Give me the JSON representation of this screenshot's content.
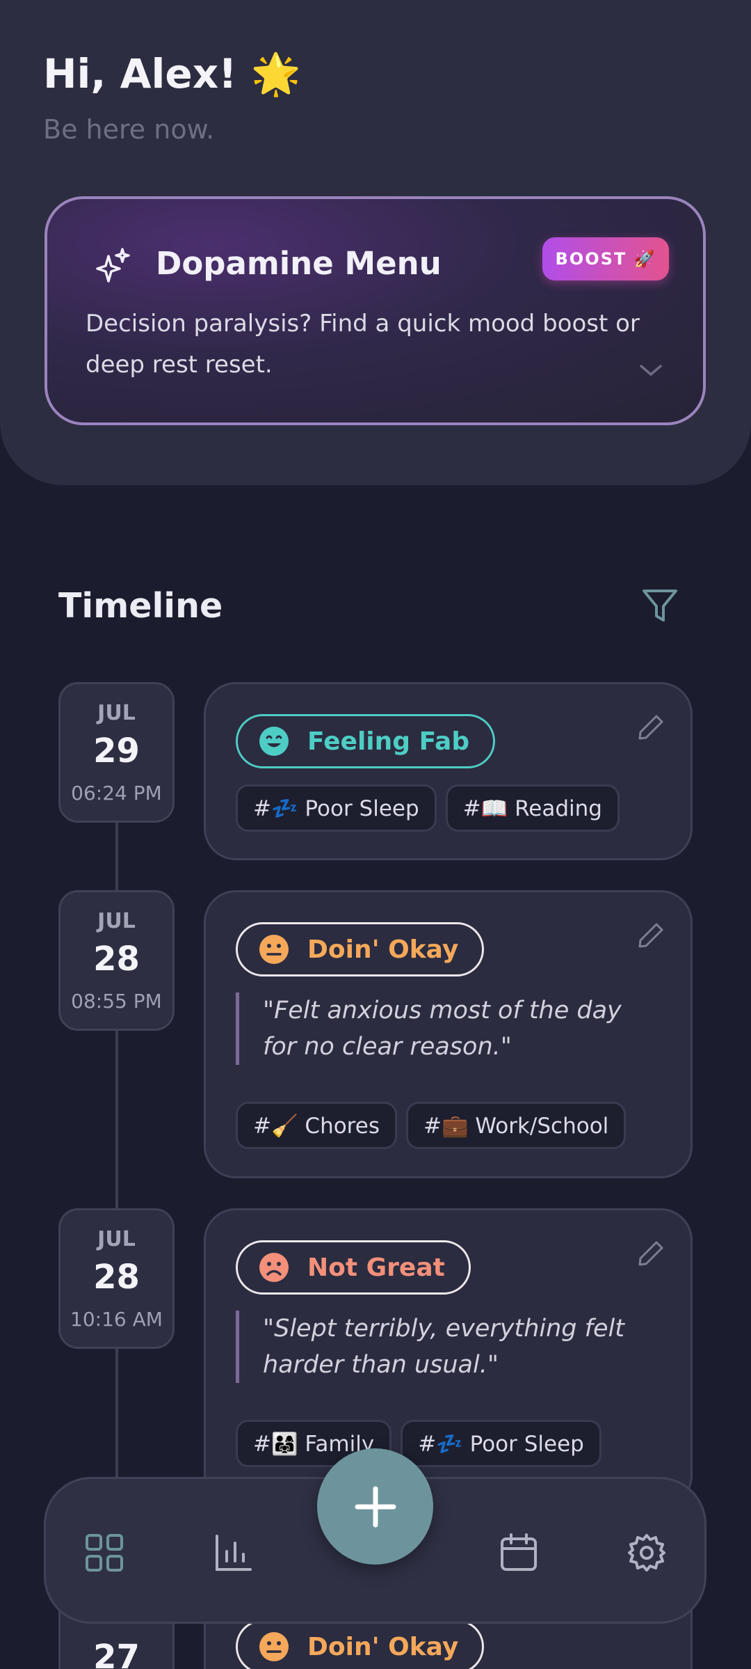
{
  "header": {
    "greeting": "Hi, Alex! 🌟",
    "subtitle": "Be here now."
  },
  "dopamine_menu": {
    "title": "Dopamine Menu",
    "boost_label": "BOOST 🚀",
    "description": "Decision paralysis? Find a quick mood boost or deep rest reset."
  },
  "timeline": {
    "title": "Timeline",
    "entries": [
      {
        "month": "JUL",
        "day": "29",
        "time": "06:24 PM",
        "mood": "Feeling Fab",
        "mood_color": "#4ecdc4",
        "note": "",
        "tags": [
          "#💤 Poor Sleep",
          "#📖 Reading"
        ]
      },
      {
        "month": "JUL",
        "day": "28",
        "time": "08:55 PM",
        "mood": "Doin' Okay",
        "mood_color": "#f5a85a",
        "note": "\"Felt anxious most of the day for no clear reason.\"",
        "tags": [
          "#🧹 Chores",
          "#💼 Work/School"
        ]
      },
      {
        "month": "JUL",
        "day": "28",
        "time": "10:16 AM",
        "mood": "Not Great",
        "mood_color": "#f4907a",
        "note": "\"Slept terribly, everything felt harder than usual.\"",
        "tags": [
          "#👨‍👩‍👧 Family",
          "#💤 Poor Sleep"
        ]
      },
      {
        "month": "",
        "day": "27",
        "time": "",
        "mood": "Doin' Okay",
        "mood_color": "#f5a85a",
        "note": "",
        "tags": []
      }
    ]
  },
  "nav": {
    "items": [
      "grid-icon",
      "bar-chart-icon",
      "add-icon",
      "calendar-icon",
      "settings-icon"
    ],
    "accent": "#6d949c"
  }
}
